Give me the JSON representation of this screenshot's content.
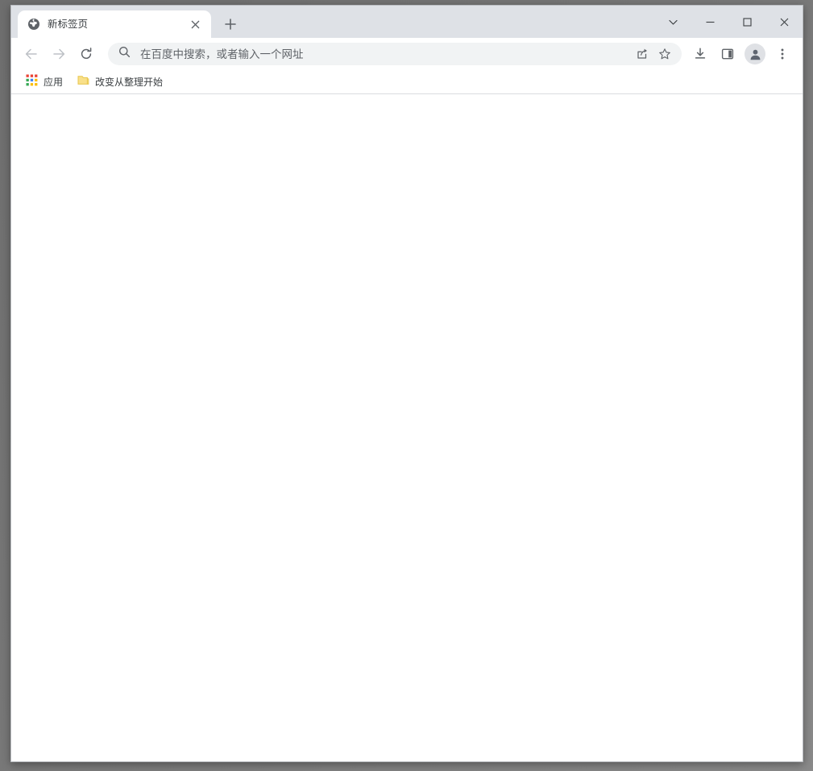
{
  "window": {
    "controls": {
      "tab_search_label": "搜索标签页",
      "minimize_label": "最小化",
      "maximize_label": "最大化",
      "close_label": "关闭"
    }
  },
  "tabstrip": {
    "tabs": [
      {
        "title": "新标签页",
        "favicon": "globe-icon",
        "close_label": "×",
        "active": true
      }
    ],
    "new_tab_label": "+",
    "new_tab_tooltip": "新建标签页"
  },
  "toolbar": {
    "back_label": "后退",
    "forward_label": "前进",
    "reload_label": "重新加载",
    "share_label": "分享",
    "bookmark_label": "将此标签页加入书签",
    "downloads_label": "下载内容",
    "side_panel_label": "显示侧边栏",
    "profile_label": "个人资料",
    "menu_label": "自定义及控制 Google Chrome"
  },
  "omnibox": {
    "value": "",
    "placeholder": "在百度中搜索，或者输入一个网址",
    "search_icon": "search-icon"
  },
  "bookmarks": {
    "items": [
      {
        "label": "应用",
        "icon": "apps-grid-icon"
      },
      {
        "label": "改变从整理开始",
        "icon": "folder-icon"
      }
    ]
  },
  "page": {
    "body_text": ""
  },
  "colors": {
    "frame": "#dee1e6",
    "toolbar": "#ffffff",
    "omnibox_bg": "#f1f3f4",
    "text": "#3c4043",
    "placeholder": "#5f6368",
    "folder_yellow": "#f7d774",
    "apps_red": "#ea4335",
    "apps_blue": "#4285f4",
    "apps_green": "#34a853",
    "apps_yellow": "#fbbc05"
  }
}
